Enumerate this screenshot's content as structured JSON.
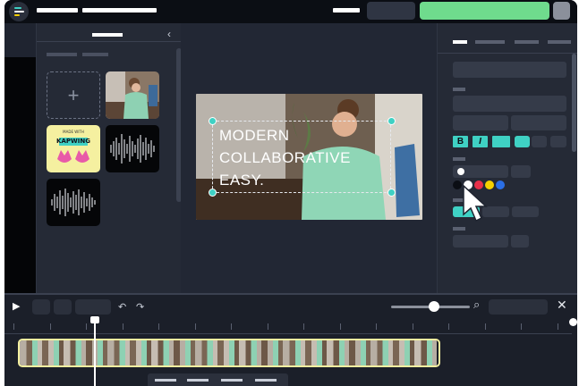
{
  "canvas": {
    "headline_lines": [
      "MODERN",
      "COLLABORATIVE",
      "EASY."
    ]
  },
  "media": {
    "thumbnails": [
      {
        "type": "upload",
        "symbol": "+"
      },
      {
        "type": "video"
      },
      {
        "type": "sticker",
        "badge_text": "MADE WITH",
        "brand_text": "KAPWING"
      },
      {
        "type": "audio"
      },
      {
        "type": "audio"
      }
    ],
    "collapse_symbol": "‹"
  },
  "props": {
    "format_buttons": [
      "B",
      "I",
      ""
    ],
    "colors": [
      "#0b0e14",
      "#ffffff",
      "#e8304a",
      "#f5d000",
      "#2b6fe6"
    ]
  },
  "timeline": {
    "play_symbol": "▶",
    "undo_symbol": "↶",
    "redo_symbol": "↷",
    "zoom_symbol": "⌕",
    "zoom_level": 0.55,
    "close_symbol": "✕"
  },
  "colors": {
    "accent_teal": "#3fd1c4",
    "export_green": "#6fdb8d",
    "track_border": "#f3efa0"
  }
}
